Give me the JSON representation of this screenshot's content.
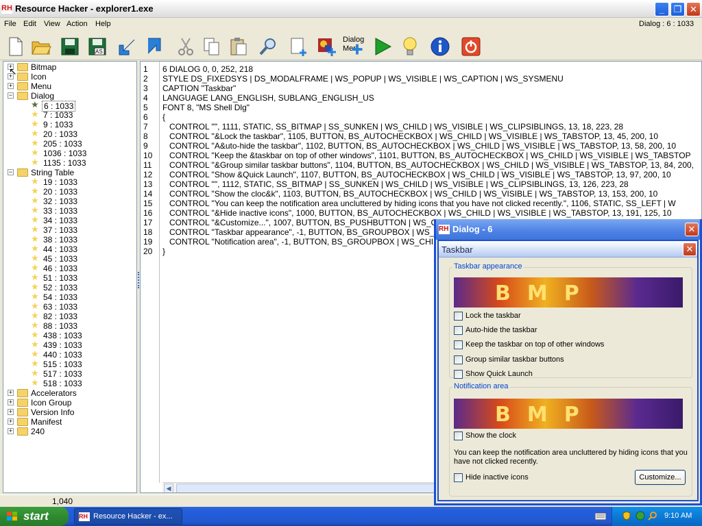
{
  "window": {
    "logo": "RH",
    "title": "Resource Hacker - explorer1.exe"
  },
  "menu": {
    "items": [
      "File",
      "Edit",
      "View",
      "Action",
      "Help"
    ],
    "right_info": "Dialog : 6 : 1033"
  },
  "toolbar": {
    "dialog_menu_label": "Dialog Mer",
    "icons": [
      "new-file-icon",
      "open-folder-icon",
      "save-icon",
      "save-as-icon",
      "back-arrow-icon",
      "forward-arrow-icon",
      "cut-icon",
      "copy-icon",
      "paste-icon",
      "find-icon",
      "add-resource-icon",
      "add-image-icon",
      "dialog-menu-icon",
      "run-icon",
      "tips-icon",
      "info-icon",
      "power-icon"
    ],
    "save_as_label": "AS"
  },
  "tree": {
    "top": [
      {
        "label": "Bitmap",
        "sign": "+"
      },
      {
        "label": "Icon",
        "sign": "+"
      },
      {
        "label": "Menu",
        "sign": "+"
      },
      {
        "label": "Dialog",
        "sign": "−"
      }
    ],
    "dialog_children": [
      "6 : 1033",
      "7 : 1033",
      "9 : 1033",
      "20 : 1033",
      "205 : 1033",
      "1036 : 1033",
      "1135 : 1033"
    ],
    "string_table": {
      "label": "String Table",
      "sign": "−"
    },
    "string_children": [
      "19 : 1033",
      "20 : 1033",
      "32 : 1033",
      "33 : 1033",
      "34 : 1033",
      "37 : 1033",
      "38 : 1033",
      "44 : 1033",
      "45 : 1033",
      "46 : 1033",
      "51 : 1033",
      "52 : 1033",
      "54 : 1033",
      "63 : 1033",
      "82 : 1033",
      "88 : 1033",
      "438 : 1033",
      "439 : 1033",
      "440 : 1033",
      "515 : 1033",
      "517 : 1033",
      "518 : 1033"
    ],
    "bottom": [
      {
        "label": "Accelerators",
        "sign": "+"
      },
      {
        "label": "Icon Group",
        "sign": "+"
      },
      {
        "label": "Version Info",
        "sign": "+"
      },
      {
        "label": "Manifest",
        "sign": "+"
      },
      {
        "label": "240",
        "sign": "+"
      }
    ]
  },
  "editor": {
    "line_numbers": [
      "1",
      "2",
      "3",
      "4",
      "5",
      "6",
      "7",
      "8",
      "9",
      "10",
      "11",
      "12",
      "13",
      "14",
      "15",
      "16",
      "17",
      "18",
      "19",
      "20"
    ],
    "lines": [
      "6 DIALOG 0, 0, 252, 218",
      "STYLE DS_FIXEDSYS | DS_MODALFRAME | WS_POPUP | WS_VISIBLE | WS_CAPTION | WS_SYSMENU",
      "CAPTION \"Taskbar\"",
      "LANGUAGE LANG_ENGLISH, SUBLANG_ENGLISH_US",
      "FONT 8, \"MS Shell Dlg\"",
      "{",
      "   CONTROL \"\", 1111, STATIC, SS_BITMAP | SS_SUNKEN | WS_CHILD | WS_VISIBLE | WS_CLIPSIBLINGS, 13, 18, 223, 28",
      "   CONTROL \"&Lock the taskbar\", 1105, BUTTON, BS_AUTOCHECKBOX | WS_CHILD | WS_VISIBLE | WS_TABSTOP, 13, 45, 200, 10",
      "   CONTROL \"A&uto-hide the taskbar\", 1102, BUTTON, BS_AUTOCHECKBOX | WS_CHILD | WS_VISIBLE | WS_TABSTOP, 13, 58, 200, 10",
      "   CONTROL \"Keep the &taskbar on top of other windows\", 1101, BUTTON, BS_AUTOCHECKBOX | WS_CHILD | WS_VISIBLE | WS_TABSTOP",
      "   CONTROL \"&Group similar taskbar buttons\", 1104, BUTTON, BS_AUTOCHECKBOX | WS_CHILD | WS_VISIBLE | WS_TABSTOP, 13, 84, 200,",
      "   CONTROL \"Show &Quick Launch\", 1107, BUTTON, BS_AUTOCHECKBOX | WS_CHILD | WS_VISIBLE | WS_TABSTOP, 13, 97, 200, 10",
      "   CONTROL \"\", 1112, STATIC, SS_BITMAP | SS_SUNKEN | WS_CHILD | WS_VISIBLE | WS_CLIPSIBLINGS, 13, 126, 223, 28",
      "   CONTROL \"Show the cloc&k\", 1103, BUTTON, BS_AUTOCHECKBOX | WS_CHILD | WS_VISIBLE | WS_TABSTOP, 13, 153, 200, 10",
      "   CONTROL \"You can keep the notification area uncluttered by hiding icons that you have not clicked recently.\", 1106, STATIC, SS_LEFT | W",
      "   CONTROL \"&Hide inactive icons\", 1000, BUTTON, BS_AUTOCHECKBOX | WS_CHILD | WS_VISIBLE | WS_TABSTOP, 13, 191, 125, 10",
      "   CONTROL \"&Customize...\", 1007, BUTTON, BS_PUSHBUTTON | WS_C",
      "   CONTROL \"Taskbar appearance\", -1, BUTTON, BS_GROUPBOX | WS_C",
      "   CONTROL \"Notification area\", -1, BUTTON, BS_GROUPBOX | WS_CHIL",
      "}"
    ]
  },
  "status": {
    "position": "1,040"
  },
  "dialog": {
    "logo": "RH",
    "title": "Dialog -  6",
    "inner_title": "Taskbar",
    "group1_label": "Taskbar appearance",
    "bmp_text": "BMP",
    "checkboxes1": [
      "Lock the taskbar",
      "Auto-hide the taskbar",
      "Keep the taskbar on top of other windows",
      "Group similar taskbar buttons",
      "Show Quick Launch"
    ],
    "group2_label": "Notification area",
    "show_clock": "Show the clock",
    "note": "You can keep the notification area uncluttered by hiding icons that you have not clicked recently.",
    "hide_inactive": "Hide inactive icons",
    "customize": "Customize...",
    "close_glyph": "✕"
  },
  "taskbar": {
    "start_label": "start",
    "task_logo": "RH",
    "task_label": "Resource Hacker - ex...",
    "clock": "9:10 AM"
  },
  "colors": {
    "xp_blue": "#245edb",
    "start_green": "#3c9e3c",
    "group_legend": "#0046d5"
  }
}
